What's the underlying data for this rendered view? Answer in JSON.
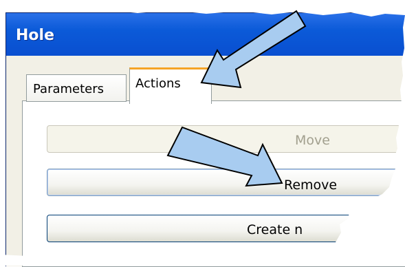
{
  "window": {
    "title": "Hole"
  },
  "tabs": [
    {
      "label": "Parameters",
      "selected": false
    },
    {
      "label": "Actions",
      "selected": true
    }
  ],
  "actions": {
    "move_label": "Move",
    "remove_label": "Remove",
    "create_label": "Create n"
  },
  "colors": {
    "titlebar": "#0b5ad8",
    "tab_highlight": "#f5a326",
    "arrow_fill": "#a8ccf0",
    "arrow_outline": "#000000"
  }
}
